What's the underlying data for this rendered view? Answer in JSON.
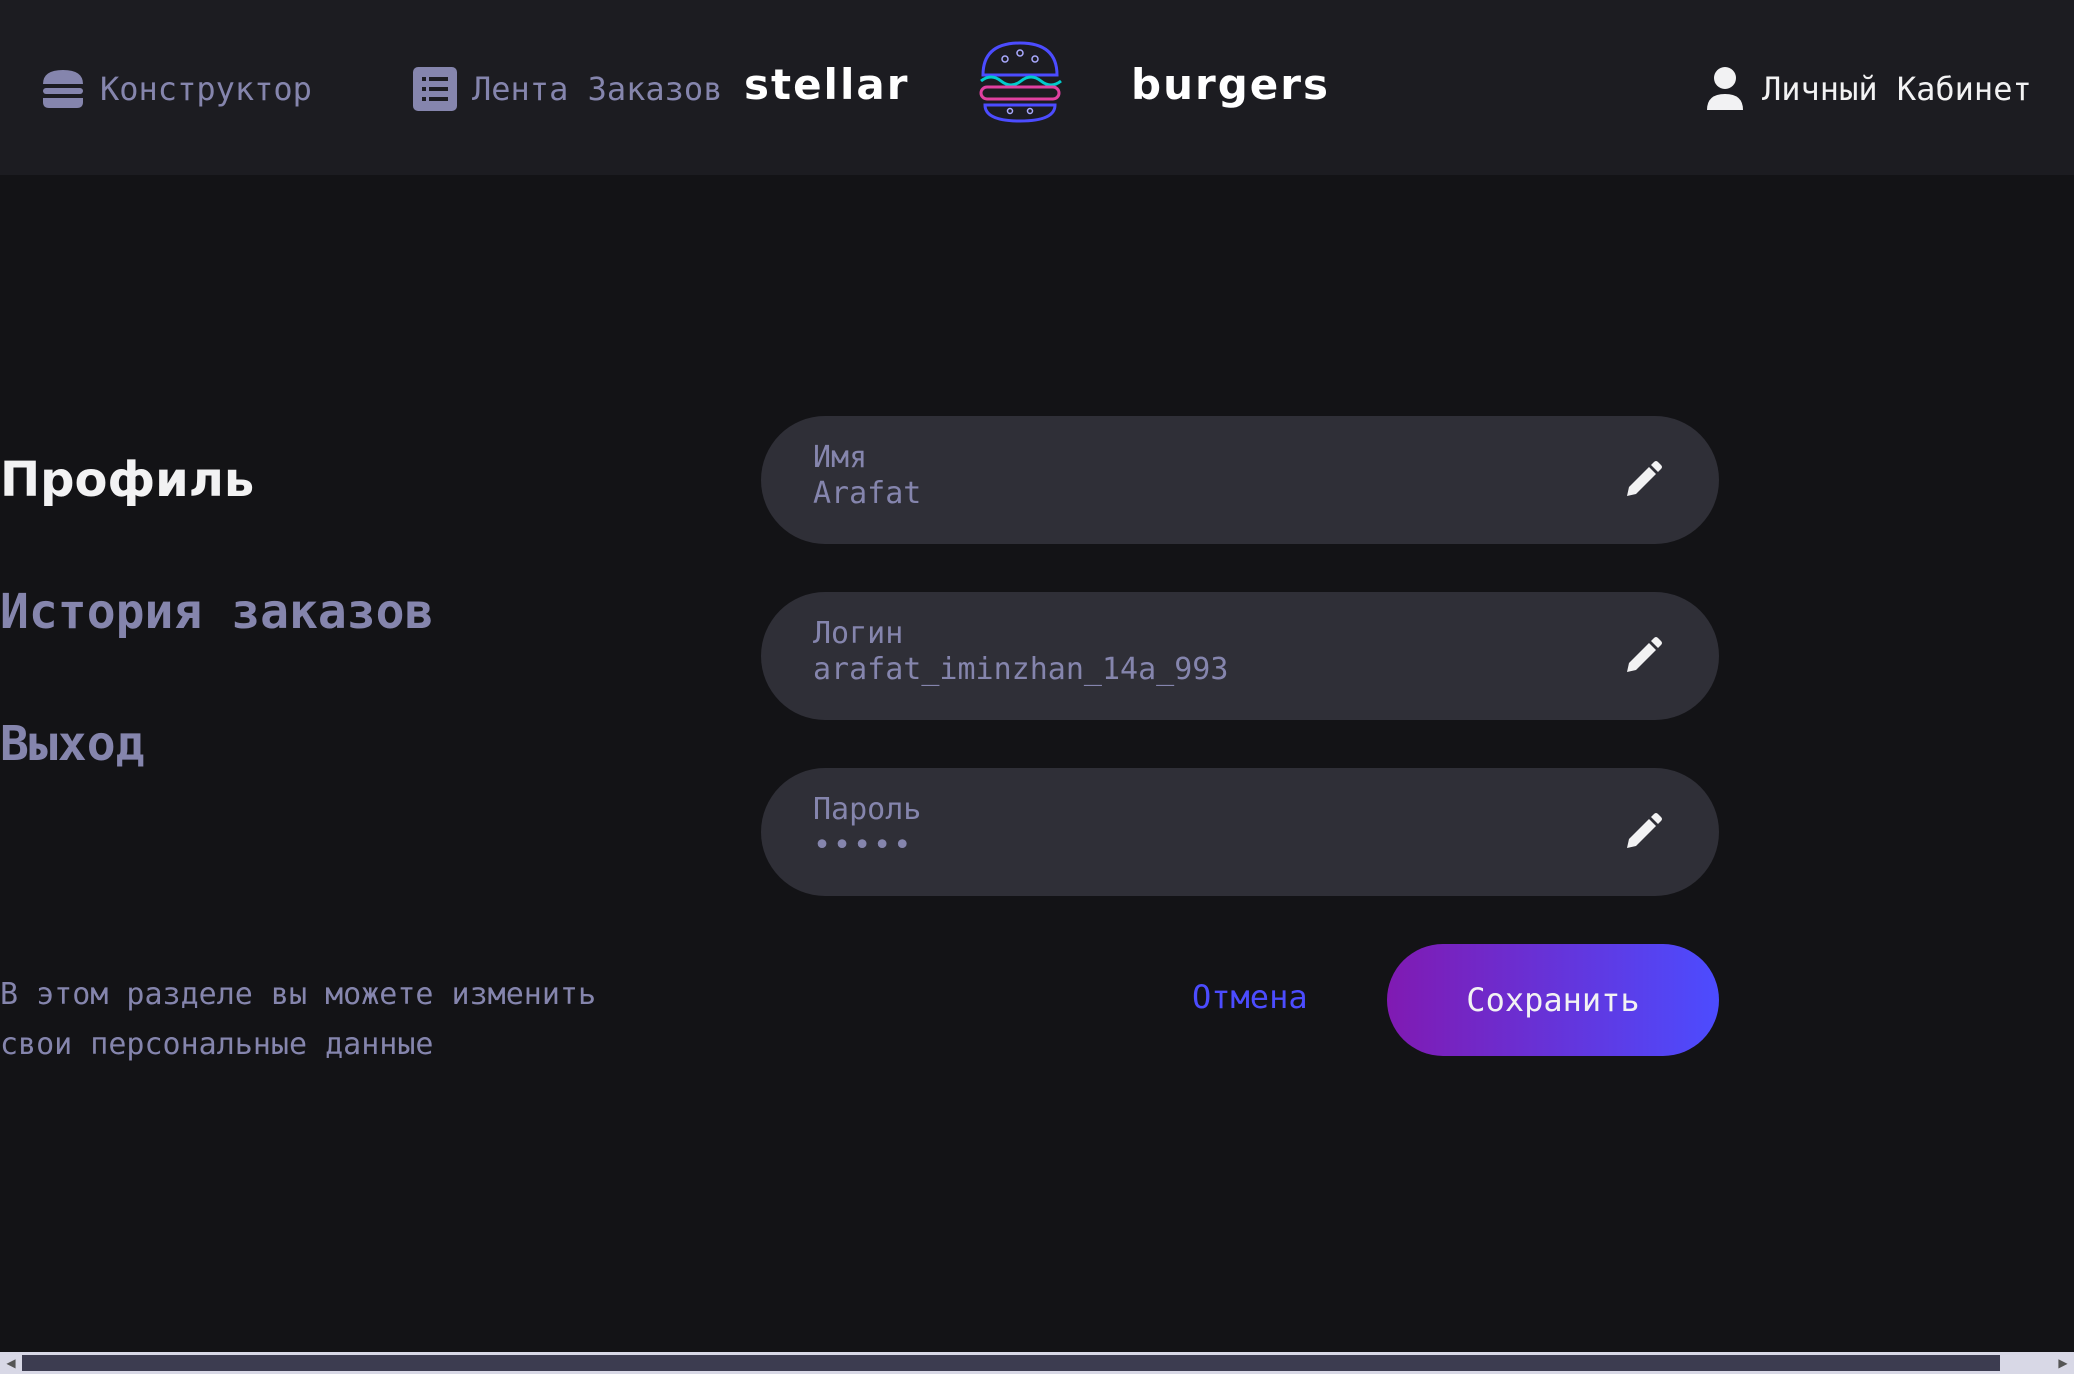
{
  "colors": {
    "background": "#131316",
    "header": "#1c1c21",
    "field_bg": "#2f2f37",
    "inactive_text": "#8585ad",
    "primary_text": "#f2f2f3",
    "accent_link": "#4c4cff",
    "button_gradient_start": "#801ab2",
    "button_gradient_end": "#4c4cff"
  },
  "header": {
    "constructor": {
      "label": "Конструктор",
      "icon": "burger-icon"
    },
    "feed": {
      "label": "Лента Заказов",
      "icon": "list-icon"
    },
    "logo": {
      "left_text": "stellar",
      "right_text": "burgers",
      "icon": "burger-logo-icon"
    },
    "account": {
      "label": "Личный Кабинет",
      "icon": "profile-icon"
    }
  },
  "sidebar": {
    "items": [
      {
        "label": "Профиль",
        "active": true
      },
      {
        "label": "История заказов",
        "active": false
      },
      {
        "label": "Выход",
        "active": false
      }
    ],
    "hint": "В этом разделе вы можете изменить свои персональные данные"
  },
  "form": {
    "fields": [
      {
        "label": "Имя",
        "value": "Arafat",
        "icon": "edit-icon"
      },
      {
        "label": "Логин",
        "value": "arafat_iminzhan_14a_993",
        "icon": "edit-icon"
      },
      {
        "label": "Пароль",
        "value": "•••••",
        "icon": "edit-icon"
      }
    ],
    "cancel_label": "Отмена",
    "save_label": "Сохранить"
  }
}
